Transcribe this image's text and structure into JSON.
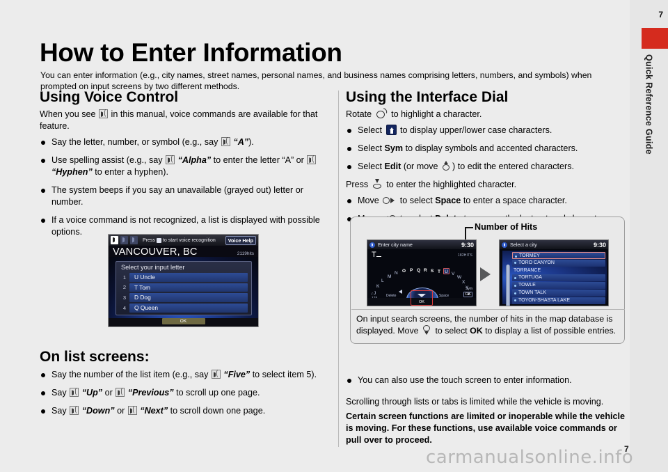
{
  "page": {
    "title": "How to Enter Information",
    "number": "7",
    "side_tab_label": "Quick Reference Guide",
    "tab_color": "#d52b1e",
    "intro": "You can enter information (e.g., city names, street names, personal names, and business names comprising letters, numbers, and symbols) when prompted on input screens by two different methods.",
    "watermark": "carmanualsonline.info"
  },
  "left_column": {
    "voice_section": {
      "heading": "Using Voice Control",
      "intro_a": "When you see",
      "intro_b": "in this manual, voice commands are available for that feature.",
      "bullets": [
        {
          "pre": "Say the letter, number, or symbol (e.g., say",
          "quote": "“A”",
          "post": ")."
        },
        {
          "pre": "Use spelling assist (e.g., say",
          "quote": "“Alpha”",
          "mid": "to enter the letter “A” or",
          "quote2": "“Hyphen”",
          "post": "to enter a hyphen)."
        },
        {
          "pre": "The system beeps if you say an unavailable (grayed out) letter or number."
        },
        {
          "pre": "If a voice command is not recognized, a list is displayed with possible options."
        }
      ]
    },
    "list_section": {
      "heading": "On list screens:",
      "bullets": [
        {
          "pre": "Say the number of the list item (e.g., say",
          "quote": "“Five”",
          "post": "to select item 5)."
        },
        {
          "pre": "Say",
          "quote": "“Up”",
          "mid": "or",
          "quote2": "“Previous”",
          "post": "to scroll up one page."
        },
        {
          "pre": "Say",
          "quote": "“Down”",
          "mid": "or",
          "quote2": "“Next”",
          "post": "to scroll down one page."
        }
      ]
    },
    "nav_screenshot": {
      "press_text": "Press",
      "press_text_2": "to start voice recognition",
      "voice_help": "Voice Help",
      "city": "VANCOUVER, BC",
      "hits": "2119hits",
      "dialog_title": "Select your input letter",
      "rows": [
        {
          "num": "1",
          "label": "U Uncle"
        },
        {
          "num": "2",
          "label": "T Tom"
        },
        {
          "num": "3",
          "label": "D Dog"
        },
        {
          "num": "4",
          "label": "Q Queen"
        }
      ],
      "ok": "OK"
    }
  },
  "right_column": {
    "dial_section": {
      "heading": "Using the Interface Dial",
      "rotate_line_a": "Rotate",
      "rotate_line_b": "to highlight a character.",
      "bullets": [
        {
          "pre": "Select",
          "icon": "shift-key-icon",
          "post": "to display upper/lower case characters."
        },
        {
          "pre": "Select",
          "bold": "Sym",
          "post": "to display symbols and accented characters."
        },
        {
          "pre": "Select",
          "bold": "Edit",
          "mid": "(or move",
          "post": ") to edit the entered characters."
        }
      ],
      "press_line_a": "Press",
      "press_line_b": "to enter the highlighted character.",
      "move_bullets": [
        {
          "pre": "Move",
          "icon": "dial-right-icon",
          "mid": "to select",
          "bold": "Space",
          "post": "to enter a space character."
        },
        {
          "pre": "Move",
          "icon": "dial-left-icon",
          "mid": "to select",
          "bold": "Delete",
          "post": "to remove the last entered character."
        }
      ]
    },
    "callout": {
      "label": "Number of Hits",
      "caption_a": "On input search screens, the number of hits in the map database is displayed. Move",
      "caption_b": "to select",
      "caption_ok": "OK",
      "caption_c": "to display a list of possible entries.",
      "screen_left": {
        "title": "Enter city name",
        "clock": "9:30",
        "typed": "T",
        "hits": "182HITS",
        "arc_letters": [
          "J",
          "K",
          "L",
          "M",
          "N",
          "O",
          "P",
          "Q",
          "R",
          "S",
          "T",
          "U",
          "V",
          "W",
          "X",
          "Y",
          "Z"
        ],
        "selected_letter": "U",
        "delete_label": "Delete",
        "space_label": "Space",
        "sym_label": "Sym",
        "ok_label": "OK",
        "numeric_label": "123",
        "bottom_ok": "OK"
      },
      "screen_right": {
        "title": "Select a city",
        "clock": "9:30",
        "items": [
          {
            "label": "TORMEY",
            "selected": true,
            "plain": false
          },
          {
            "label": "TORO CANYON",
            "selected": false,
            "plain": false
          },
          {
            "label": "TORRANCE",
            "selected": false,
            "plain": true
          },
          {
            "label": "TORTUGA",
            "selected": false,
            "plain": false
          },
          {
            "label": "TOWLE",
            "selected": false,
            "plain": false
          },
          {
            "label": "TOWN TALK",
            "selected": false,
            "plain": false
          },
          {
            "label": "TOYON-SHASTA LAKE",
            "selected": false,
            "plain": false
          }
        ]
      }
    },
    "touch_bullet": "You can also use the touch screen to enter information.",
    "note_plain": "Scrolling through lists or tabs is limited while the vehicle is moving.",
    "note_bold": "Certain screen functions are limited or inoperable while the vehicle is moving. For these functions, use available voice commands or pull over to proceed."
  }
}
